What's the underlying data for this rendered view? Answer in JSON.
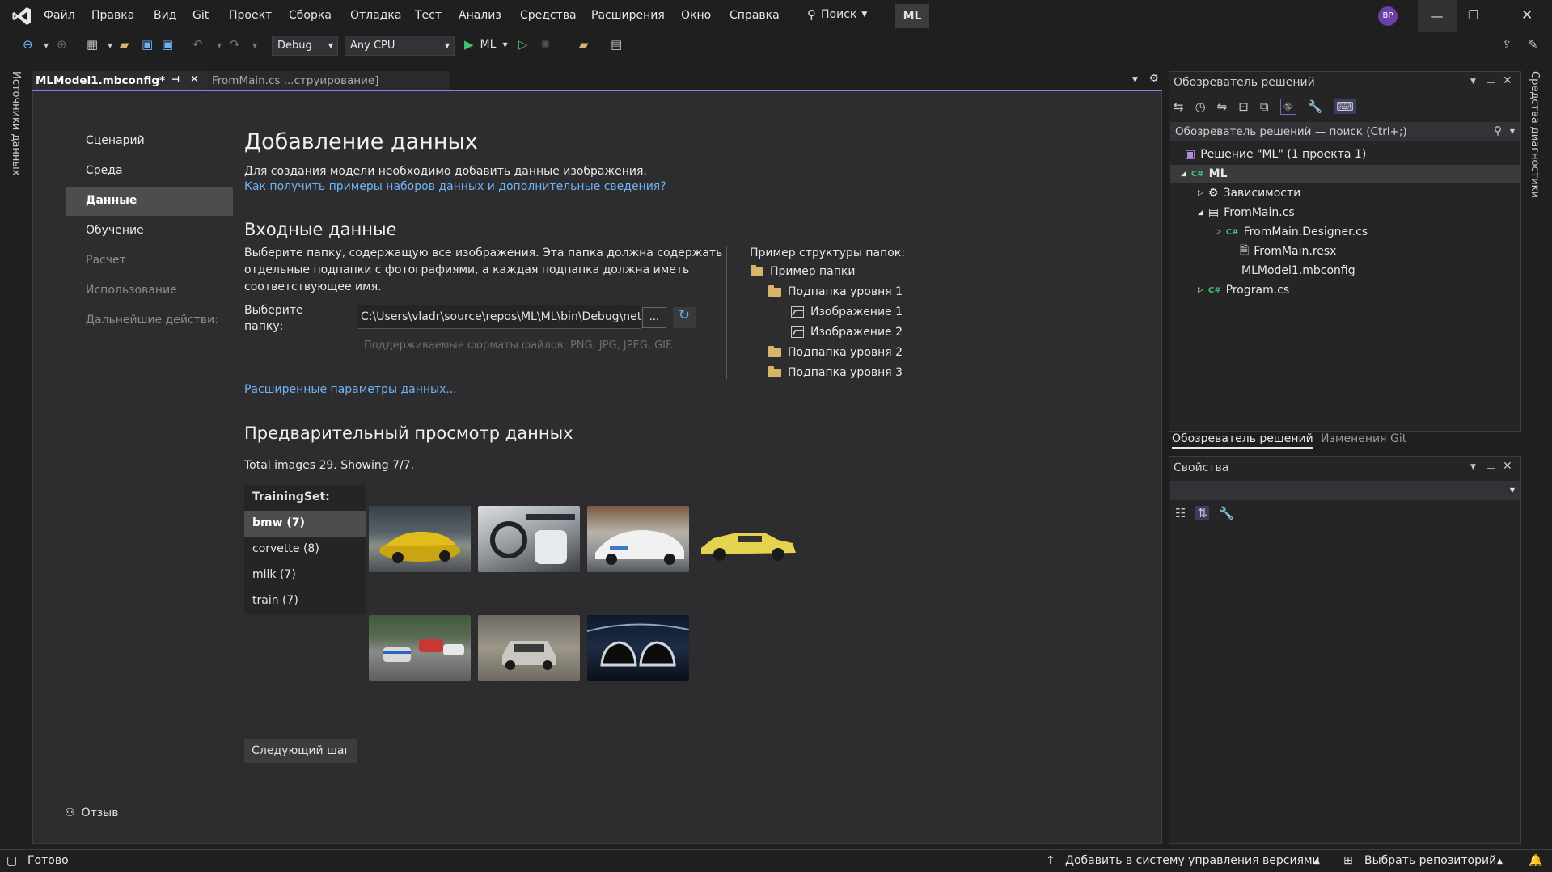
{
  "menu": [
    "Файл",
    "Правка",
    "Вид",
    "Git",
    "Проект",
    "Сборка",
    "Отладка",
    "Тест",
    "Анализ",
    "Средства",
    "Расширения",
    "Окно",
    "Справка"
  ],
  "search_label": "Поиск",
  "solution_badge": "ML",
  "user_initials": "BP",
  "toolbar": {
    "config": "Debug",
    "platform": "Any CPU",
    "run_target": "ML"
  },
  "tabs": [
    {
      "label": "MLModel1.mbconfig*",
      "active": true
    },
    {
      "label": "FromMain.cs ...струирование]",
      "active": false
    }
  ],
  "left_vertical_label": "Источники данных",
  "right_vertical_label": "Средства диагностики",
  "nav": [
    {
      "label": "Сценарий",
      "state": "enabled"
    },
    {
      "label": "Среда",
      "state": "enabled"
    },
    {
      "label": "Данные",
      "state": "selected"
    },
    {
      "label": "Обучение",
      "state": "enabled"
    },
    {
      "label": "Расчет",
      "state": "disabled"
    },
    {
      "label": "Использование",
      "state": "disabled"
    },
    {
      "label": "Дальнейшие действи:",
      "state": "disabled"
    }
  ],
  "feedback_label": "Отзыв",
  "main": {
    "title": "Добавление данных",
    "subtitle": "Для создания модели необходимо добавить данные изображения.",
    "help_link": "Как получить примеры наборов данных и дополнительные сведения?",
    "input_heading": "Входные данные",
    "input_desc": [
      "Выберите папку, содержащую все изображения. Эта папка должна содержать",
      "отдельные подпапки с фотографиями, а каждая подпапка должна иметь",
      "соответствующее имя."
    ],
    "folder_label": [
      "Выберите",
      "папку:"
    ],
    "folder_value": "C:\\Users\\vladr\\source\\repos\\ML\\ML\\bin\\Debug\\net",
    "browse_label": "...",
    "formats_hint": "Поддерживаемые форматы файлов: PNG, JPG, JPEG, GIF.",
    "example_title": "Пример структуры папок:",
    "example_tree": [
      "Пример папки",
      "Подпапка уровня 1",
      "Изображение 1",
      "Изображение 2",
      "Подпапка уровня 2",
      "Подпапка уровня 3"
    ],
    "advanced_link": "Расширенные параметры данных...",
    "preview_heading": "Предварительный просмотр данных",
    "total_text": "Total images 29. Showing 7/7.",
    "trainingset_label": "TrainingSet:",
    "classes": [
      {
        "label": "bmw (7)",
        "selected": true
      },
      {
        "label": "corvette (8)",
        "selected": false
      },
      {
        "label": "milk (7)",
        "selected": false
      },
      {
        "label": "train (7)",
        "selected": false
      }
    ],
    "thumbnails": [
      "yellow-bmw-m4",
      "car-interior",
      "white-bmw-i8",
      "yellow-bmw-classic",
      "racing-bmws",
      "bmw-suv-dust",
      "bmw-grille"
    ],
    "next_button": "Следующий шаг"
  },
  "solution_explorer": {
    "title": "Обозреватель решений",
    "search_placeholder": "Обозреватель решений — поиск (Ctrl+;)",
    "solution_row": "Решение \"ML\"  (1 проекта 1)",
    "items": [
      "ML",
      "Зависимости",
      "FromMain.cs",
      "FromMain.Designer.cs",
      "FromMain.resx",
      "MLModel1.mbconfig",
      "Program.cs"
    ],
    "tab_solution": "Обозреватель решений",
    "tab_git": "Изменения Git"
  },
  "properties": {
    "title": "Свойства"
  },
  "status": {
    "ready": "Готово",
    "add_vcs": "Добавить в систему управления версиями",
    "select_repo": "Выбрать репозиторий"
  },
  "colors": {
    "accent": "#8f7ee7",
    "link": "#6fb3f2",
    "selected_nav": "#4d4d50",
    "run_green": "#3ec46d"
  }
}
